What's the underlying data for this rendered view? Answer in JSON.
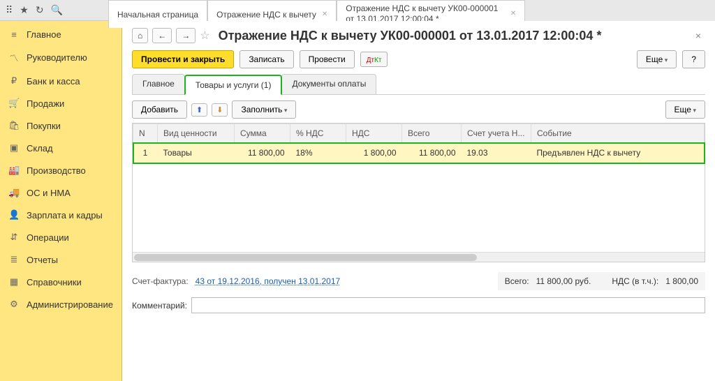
{
  "top_tabs": [
    {
      "label": "Начальная страница",
      "closable": false
    },
    {
      "label": "Отражение НДС к вычету",
      "closable": true
    },
    {
      "label": "Отражение НДС к вычету УК00-000001 от 13.01.2017 12:00:04 *",
      "closable": true,
      "active": true
    }
  ],
  "sidebar": {
    "items": [
      {
        "icon": "≡",
        "label": "Главное"
      },
      {
        "icon": "〽",
        "label": "Руководителю"
      },
      {
        "icon": "₽",
        "label": "Банк и касса"
      },
      {
        "icon": "🛒",
        "label": "Продажи"
      },
      {
        "icon": "🛍",
        "label": "Покупки"
      },
      {
        "icon": "▣",
        "label": "Склад"
      },
      {
        "icon": "🏭",
        "label": "Производство"
      },
      {
        "icon": "🚚",
        "label": "ОС и НМА"
      },
      {
        "icon": "👤",
        "label": "Зарплата и кадры"
      },
      {
        "icon": "⇵",
        "label": "Операции"
      },
      {
        "icon": "≣",
        "label": "Отчеты"
      },
      {
        "icon": "▦",
        "label": "Справочники"
      },
      {
        "icon": "⚙",
        "label": "Администрирование"
      }
    ]
  },
  "document": {
    "title": "Отражение НДС к вычету УК00-000001 от 13.01.2017 12:00:04 *",
    "actions": {
      "post_close": "Провести и закрыть",
      "save": "Записать",
      "post": "Провести",
      "more": "Еще",
      "help": "?"
    },
    "sub_tabs": [
      {
        "label": "Главное"
      },
      {
        "label": "Товары и услуги (1)",
        "active": true
      },
      {
        "label": "Документы оплаты"
      }
    ],
    "table_toolbar": {
      "add": "Добавить",
      "fill": "Заполнить",
      "more": "Еще"
    },
    "table": {
      "columns": [
        "N",
        "Вид ценности",
        "Сумма",
        "% НДС",
        "НДС",
        "Всего",
        "Счет учета Н...",
        "Событие"
      ],
      "rows": [
        {
          "n": "1",
          "type": "Товары",
          "sum": "11 800,00",
          "vat_rate": "18%",
          "vat": "1 800,00",
          "total": "11 800,00",
          "account": "19.03",
          "event": "Предъявлен НДС к вычету"
        }
      ]
    },
    "footer": {
      "invoice_label": "Счет-фактура:",
      "invoice_link": "43 от 19.12.2016, получен 13.01.2017",
      "total_label": "Всего:",
      "total_value": "11 800,00",
      "currency": "руб.",
      "vat_label": "НДС (в т.ч.):",
      "vat_value": "1 800,00"
    },
    "comment": {
      "label": "Комментарий:",
      "value": ""
    }
  }
}
